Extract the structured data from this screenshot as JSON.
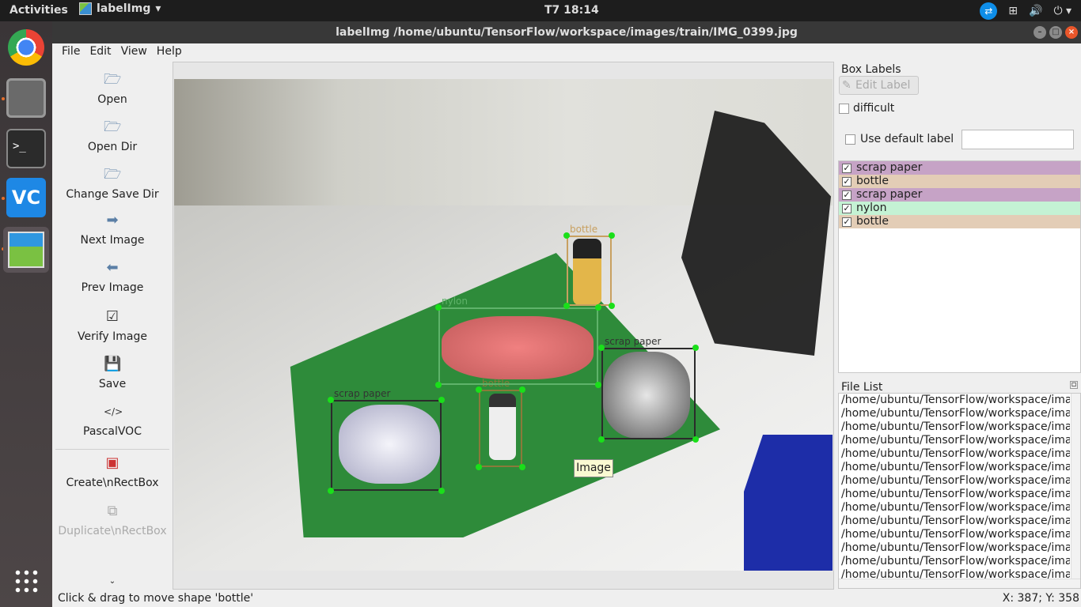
{
  "topbar": {
    "activities": "Activities",
    "app_name": "labelImg",
    "clock": "T7 18:14"
  },
  "window": {
    "title": "labelImg /home/ubuntu/TensorFlow/workspace/images/train/IMG_0399.jpg"
  },
  "menubar": [
    "File",
    "Edit",
    "View",
    "Help"
  ],
  "toolbar": [
    {
      "label": "Open",
      "icon": "folder-open-icon"
    },
    {
      "label": "Open Dir",
      "icon": "folder-open-icon"
    },
    {
      "label": "Change Save Dir",
      "icon": "folder-open-icon"
    },
    {
      "label": "Next Image",
      "icon": "arrow-right-icon"
    },
    {
      "label": "Prev Image",
      "icon": "arrow-left-icon"
    },
    {
      "label": "Verify Image",
      "icon": "check-box-icon"
    },
    {
      "label": "Save",
      "icon": "floppy-disk-icon"
    },
    {
      "label": "PascalVOC",
      "icon": "code-icon"
    },
    {
      "label": "Create\\nRectBox",
      "icon": "draw-rect-icon"
    },
    {
      "label": "Duplicate\\nRectBox",
      "icon": "copy-icon"
    }
  ],
  "canvas": {
    "tooltip": "Image",
    "boxes": [
      {
        "label": "scrap paper",
        "color": "#2b2b2b"
      },
      {
        "label": "bottle",
        "color": "#8a7a3a"
      },
      {
        "label": "nylon",
        "color": "#5fb36a"
      },
      {
        "label": "scrap paper",
        "color": "#2b2b2b"
      },
      {
        "label": "bottle",
        "color": "#c8a060"
      }
    ]
  },
  "box_labels": {
    "title": "Box Labels",
    "edit_label": "Edit Label",
    "difficult": "difficult",
    "use_default_label": "Use default label",
    "default_label_value": "",
    "items": [
      {
        "text": "scrap paper",
        "checked": true,
        "color": "#c6a3c6"
      },
      {
        "text": "bottle",
        "checked": true,
        "color": "#e3cdb6"
      },
      {
        "text": "scrap paper",
        "checked": true,
        "color": "#c6a3c6"
      },
      {
        "text": "nylon",
        "checked": true,
        "color": "#c4f2d4"
      },
      {
        "text": "bottle",
        "checked": true,
        "color": "#e3cdb6"
      }
    ]
  },
  "file_list": {
    "title": "File List",
    "items": [
      "/home/ubuntu/TensorFlow/workspace/ima",
      "/home/ubuntu/TensorFlow/workspace/ima",
      "/home/ubuntu/TensorFlow/workspace/ima",
      "/home/ubuntu/TensorFlow/workspace/ima",
      "/home/ubuntu/TensorFlow/workspace/ima",
      "/home/ubuntu/TensorFlow/workspace/ima",
      "/home/ubuntu/TensorFlow/workspace/ima",
      "/home/ubuntu/TensorFlow/workspace/ima",
      "/home/ubuntu/TensorFlow/workspace/ima",
      "/home/ubuntu/TensorFlow/workspace/ima",
      "/home/ubuntu/TensorFlow/workspace/ima",
      "/home/ubuntu/TensorFlow/workspace/ima",
      "/home/ubuntu/TensorFlow/workspace/ima",
      "/home/ubuntu/TensorFlow/workspace/ima"
    ]
  },
  "statusbar": {
    "message": "Click & drag to move shape 'bottle'",
    "coords": "X: 387; Y: 358"
  }
}
